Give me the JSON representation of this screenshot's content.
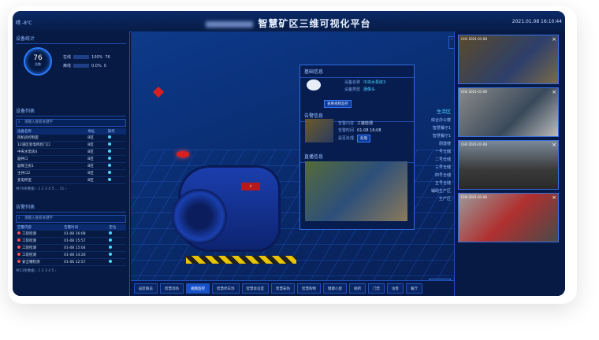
{
  "header": {
    "weather": "晴  -8℃",
    "title": "智慧矿区三维可视化平台",
    "datetime": "2021.01.08  16:10:44"
  },
  "device_stats": {
    "heading": "设备统计",
    "total": "76",
    "total_label": "总数",
    "rows": [
      {
        "label": "在线",
        "percent": "100%",
        "count": "76"
      },
      {
        "label": "离线",
        "percent": "0.0%",
        "count": "0"
      }
    ]
  },
  "device_list": {
    "heading": "设备列表",
    "search_placeholder": "请输入搜索关键字",
    "columns": [
      "设备名称",
      "地址",
      "操作"
    ],
    "rows": [
      [
        "风机房控制室",
        "B区",
        ""
      ],
      [
        "12道区变电所后门口",
        "B区",
        ""
      ],
      [
        "中央水泵房4",
        "B区",
        ""
      ],
      [
        "副井口",
        "B区",
        ""
      ],
      [
        "副保卫房1",
        "B区",
        ""
      ],
      [
        "主井口2",
        "B区",
        ""
      ],
      [
        "变电所室",
        "B区",
        ""
      ]
    ],
    "pager": "共76条数据   ‹  1  2  3  4  5  ...  11  ›"
  },
  "alarm_list": {
    "heading": "告警列表",
    "search_placeholder": "请输入搜索关键字",
    "columns": [
      "告警内容",
      "告警时间",
      "定位"
    ],
    "rows": [
      [
        "工装检测",
        "01-08 16:08"
      ],
      [
        "工装检测",
        "01-08 15:57"
      ],
      [
        "工装检测",
        "01-08 15:04"
      ],
      [
        "工装检测",
        "01-08 14:26"
      ],
      [
        "安全帽检测",
        "01-06 12:57"
      ]
    ],
    "pager": "共23条数据   ‹  1  2  3  4  5  ›"
  },
  "info_panel": {
    "basic_heading": "基础信息",
    "device_name_label": "设备名称",
    "device_name": "中央水泵房3",
    "device_type_label": "设备类型",
    "device_type": "摄像头",
    "view_video_button": "查看视频监控",
    "alarm_heading": "告警信息",
    "alarm_content_label": "告警内容",
    "alarm_content": "工装检测",
    "alarm_time_label": "告警时间",
    "alarm_time": "01-08 16:08",
    "alarm_status_label": "是否处理",
    "alarm_status_button": "处理",
    "live_heading": "直播信息"
  },
  "zones": [
    "生活区",
    "综合办公楼",
    "智慧餐厅1",
    "智慧餐厅1",
    "厨建楼",
    "一号仓储",
    "二号仓储",
    "三号仓储",
    "四号仓储",
    "五号仓储",
    "辅助生产区",
    "生产区"
  ],
  "back_button": "返回",
  "camera_feeds": [
    {
      "label": "CH1 2021-01-08"
    },
    {
      "label": "CH2 2021-01-08"
    },
    {
      "label": "CH3 2021-01-08"
    },
    {
      "label": "CH4 2021-01-08"
    }
  ],
  "bottom_nav": [
    "园区概览",
    "智慧消防",
    "视频监控",
    "智慧停车场",
    "智慧会议室",
    "智慧安防",
    "智慧购物",
    "健康小屋",
    "厕所",
    "门禁",
    "访客",
    "餐厅"
  ],
  "active_nav_index": 2
}
